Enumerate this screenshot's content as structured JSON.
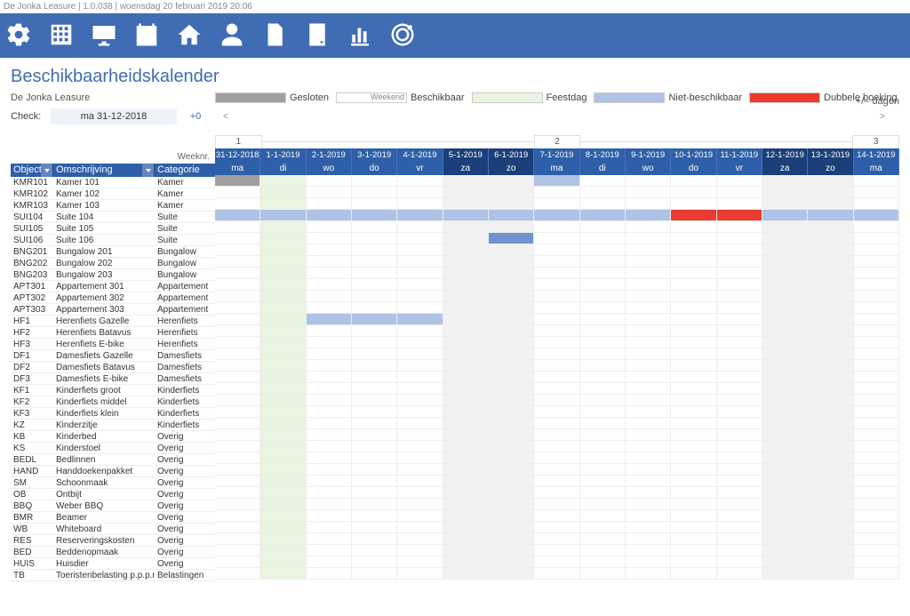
{
  "titlebar": "De Jonka Leasure | 1.0.038 | woensdag 20 februari 2019 20:06",
  "page_title": "Beschikbaarheidskalender",
  "legend_left": "De Jonka Leasure",
  "legend": {
    "gesloten": "Gesloten",
    "weekend": "Weekend",
    "beschikbaar": "Beschikbaar",
    "feestdag": "Feestdag",
    "niet_beschikbaar": "Niet-beschikbaar",
    "dubbele_boeking": "Dubbele boeking"
  },
  "colors": {
    "gesloten": "#9fa0a1",
    "weekend_swatch": "#ffffff",
    "weekend_label_bg": "#eeeeee",
    "beschikbaar": "#ffffff",
    "feestdag": "#e9f5e0",
    "niet_beschikbaar": "#aec3e6",
    "dubbele_boeking": "#e93b2f",
    "header_blue": "#2E5FA9"
  },
  "check": {
    "label": "Check:",
    "date": "ma 31-12-2018",
    "offset": "+0",
    "dagen_label": "+/– dagen"
  },
  "weeknr_label": "Weeknr.",
  "headers": {
    "object": "Object",
    "omschrijving": "Omschrijving",
    "categorie": "Categorie"
  },
  "dates": [
    {
      "date": "31-12-2018",
      "day": "ma"
    },
    {
      "date": "1-1-2019",
      "day": "di"
    },
    {
      "date": "2-1-2019",
      "day": "wo"
    },
    {
      "date": "3-1-2019",
      "day": "do"
    },
    {
      "date": "4-1-2019",
      "day": "vr"
    },
    {
      "date": "5-1-2019",
      "day": "za"
    },
    {
      "date": "6-1-2019",
      "day": "zo"
    },
    {
      "date": "7-1-2019",
      "day": "ma"
    },
    {
      "date": "8-1-2019",
      "day": "di"
    },
    {
      "date": "9-1-2019",
      "day": "wo"
    },
    {
      "date": "10-1-2019",
      "day": "do"
    },
    {
      "date": "11-1-2019",
      "day": "vr"
    },
    {
      "date": "12-1-2019",
      "day": "za"
    },
    {
      "date": "13-1-2019",
      "day": "zo"
    },
    {
      "date": "14-1-2019",
      "day": "ma"
    }
  ],
  "weeknrs": [
    {
      "label": "1",
      "span": 1
    },
    {
      "label": "",
      "span": 6
    },
    {
      "label": "2",
      "span": 1
    },
    {
      "label": "",
      "span": 6
    },
    {
      "label": "3",
      "span": 1
    }
  ],
  "rows": [
    {
      "obj": "KMR101",
      "oms": "Kamer 101",
      "cat": "Kamer",
      "cells": [
        "closed",
        "feest",
        "",
        "",
        "",
        "weekend",
        "weekend",
        "niet",
        "",
        "",
        "",
        "",
        "weekend",
        "weekend",
        ""
      ]
    },
    {
      "obj": "KMR102",
      "oms": "Kamer 102",
      "cat": "Kamer",
      "cells": [
        "",
        "feest",
        "",
        "",
        "",
        "weekend",
        "weekend",
        "",
        "",
        "",
        "",
        "",
        "weekend",
        "weekend",
        ""
      ]
    },
    {
      "obj": "KMR103",
      "oms": "Kamer 103",
      "cat": "Kamer",
      "cells": [
        "",
        "feest",
        "",
        "",
        "",
        "weekend",
        "weekend",
        "",
        "",
        "",
        "",
        "",
        "weekend",
        "weekend",
        ""
      ]
    },
    {
      "obj": "SUI104",
      "oms": "Suite 104",
      "cat": "Suite",
      "cells": [
        "niet",
        "niet",
        "niet",
        "niet",
        "niet",
        "niet",
        "niet",
        "niet",
        "niet",
        "niet",
        "dubbel",
        "dubbel",
        "niet",
        "niet",
        "niet"
      ]
    },
    {
      "obj": "SUI105",
      "oms": "Suite 105",
      "cat": "Suite",
      "cells": [
        "",
        "feest",
        "",
        "",
        "",
        "weekend",
        "weekend",
        "",
        "",
        "",
        "",
        "",
        "weekend",
        "weekend",
        ""
      ]
    },
    {
      "obj": "SUI106",
      "oms": "Suite 106",
      "cat": "Suite",
      "cells": [
        "",
        "feest",
        "",
        "",
        "",
        "weekend",
        "niethl",
        "",
        "",
        "",
        "",
        "",
        "weekend",
        "weekend",
        ""
      ]
    },
    {
      "obj": "BNG201",
      "oms": "Bungalow 201",
      "cat": "Bungalow",
      "cells": [
        "",
        "feest",
        "",
        "",
        "",
        "weekend",
        "weekend",
        "",
        "",
        "",
        "",
        "",
        "weekend",
        "weekend",
        ""
      ]
    },
    {
      "obj": "BNG202",
      "oms": "Bungalow 202",
      "cat": "Bungalow",
      "cells": [
        "",
        "feest",
        "",
        "",
        "",
        "weekend",
        "weekend",
        "",
        "",
        "",
        "",
        "",
        "weekend",
        "weekend",
        ""
      ]
    },
    {
      "obj": "BNG203",
      "oms": "Bungalow 203",
      "cat": "Bungalow",
      "cells": [
        "",
        "feest",
        "",
        "",
        "",
        "weekend",
        "weekend",
        "",
        "",
        "",
        "",
        "",
        "weekend",
        "weekend",
        ""
      ]
    },
    {
      "obj": "APT301",
      "oms": "Appartement 301",
      "cat": "Appartement",
      "cells": [
        "",
        "feest",
        "",
        "",
        "",
        "weekend",
        "weekend",
        "",
        "",
        "",
        "",
        "",
        "weekend",
        "weekend",
        ""
      ]
    },
    {
      "obj": "APT302",
      "oms": "Appartement 302",
      "cat": "Appartement",
      "cells": [
        "",
        "feest",
        "",
        "",
        "",
        "weekend",
        "weekend",
        "",
        "",
        "",
        "",
        "",
        "weekend",
        "weekend",
        ""
      ]
    },
    {
      "obj": "APT303",
      "oms": "Appartement 303",
      "cat": "Appartement",
      "cells": [
        "",
        "feest",
        "",
        "",
        "",
        "weekend",
        "weekend",
        "",
        "",
        "",
        "",
        "",
        "weekend",
        "weekend",
        ""
      ]
    },
    {
      "obj": "HF1",
      "oms": "Herenfiets Gazelle",
      "cat": "Herenfiets",
      "cells": [
        "",
        "feest",
        "niet",
        "niet",
        "niet",
        "weekend",
        "weekend",
        "",
        "",
        "",
        "",
        "",
        "weekend",
        "weekend",
        ""
      ]
    },
    {
      "obj": "HF2",
      "oms": "Herenfiets Batavus",
      "cat": "Herenfiets",
      "cells": [
        "",
        "feest",
        "",
        "",
        "",
        "weekend",
        "weekend",
        "",
        "",
        "",
        "",
        "",
        "weekend",
        "weekend",
        ""
      ]
    },
    {
      "obj": "HF3",
      "oms": "Herenfiets E-bike",
      "cat": "Herenfiets",
      "cells": [
        "",
        "feest",
        "",
        "",
        "",
        "weekend",
        "weekend",
        "",
        "",
        "",
        "",
        "",
        "weekend",
        "weekend",
        ""
      ]
    },
    {
      "obj": "DF1",
      "oms": "Damesfiets Gazelle",
      "cat": "Damesfiets",
      "cells": [
        "",
        "feest",
        "",
        "",
        "",
        "weekend",
        "weekend",
        "",
        "",
        "",
        "",
        "",
        "weekend",
        "weekend",
        ""
      ]
    },
    {
      "obj": "DF2",
      "oms": "Damesfiets Batavus",
      "cat": "Damesfiets",
      "cells": [
        "",
        "feest",
        "",
        "",
        "",
        "weekend",
        "weekend",
        "",
        "",
        "",
        "",
        "",
        "weekend",
        "weekend",
        ""
      ]
    },
    {
      "obj": "DF3",
      "oms": "Damesfiets E-bike",
      "cat": "Damesfiets",
      "cells": [
        "",
        "feest",
        "",
        "",
        "",
        "weekend",
        "weekend",
        "",
        "",
        "",
        "",
        "",
        "weekend",
        "weekend",
        ""
      ]
    },
    {
      "obj": "KF1",
      "oms": "Kinderfiets groot",
      "cat": "Kinderfiets",
      "cells": [
        "",
        "feest",
        "",
        "",
        "",
        "weekend",
        "weekend",
        "",
        "",
        "",
        "",
        "",
        "weekend",
        "weekend",
        ""
      ]
    },
    {
      "obj": "KF2",
      "oms": "Kinderfiets middel",
      "cat": "Kinderfiets",
      "cells": [
        "",
        "feest",
        "",
        "",
        "",
        "weekend",
        "weekend",
        "",
        "",
        "",
        "",
        "",
        "weekend",
        "weekend",
        ""
      ]
    },
    {
      "obj": "KF3",
      "oms": "Kinderfiets klein",
      "cat": "Kinderfiets",
      "cells": [
        "",
        "feest",
        "",
        "",
        "",
        "weekend",
        "weekend",
        "",
        "",
        "",
        "",
        "",
        "weekend",
        "weekend",
        ""
      ]
    },
    {
      "obj": "KZ",
      "oms": "Kinderzitje",
      "cat": "Kinderfiets",
      "cells": [
        "",
        "feest",
        "",
        "",
        "",
        "weekend",
        "weekend",
        "",
        "",
        "",
        "",
        "",
        "weekend",
        "weekend",
        ""
      ]
    },
    {
      "obj": "KB",
      "oms": "Kinderbed",
      "cat": "Overig",
      "cells": [
        "",
        "feest",
        "",
        "",
        "",
        "weekend",
        "weekend",
        "",
        "",
        "",
        "",
        "",
        "weekend",
        "weekend",
        ""
      ]
    },
    {
      "obj": "KS",
      "oms": "Kinderstoel",
      "cat": "Overig",
      "cells": [
        "",
        "feest",
        "",
        "",
        "",
        "weekend",
        "weekend",
        "",
        "",
        "",
        "",
        "",
        "weekend",
        "weekend",
        ""
      ]
    },
    {
      "obj": "BEDL",
      "oms": "Bedlinnen",
      "cat": "Overig",
      "cells": [
        "",
        "feest",
        "",
        "",
        "",
        "weekend",
        "weekend",
        "",
        "",
        "",
        "",
        "",
        "weekend",
        "weekend",
        ""
      ]
    },
    {
      "obj": "HAND",
      "oms": "Handdoekenpakket",
      "cat": "Overig",
      "cells": [
        "",
        "feest",
        "",
        "",
        "",
        "weekend",
        "weekend",
        "",
        "",
        "",
        "",
        "",
        "weekend",
        "weekend",
        ""
      ]
    },
    {
      "obj": "SM",
      "oms": "Schoonmaak",
      "cat": "Overig",
      "cells": [
        "",
        "feest",
        "",
        "",
        "",
        "weekend",
        "weekend",
        "",
        "",
        "",
        "",
        "",
        "weekend",
        "weekend",
        ""
      ]
    },
    {
      "obj": "OB",
      "oms": "Ontbijt",
      "cat": "Overig",
      "cells": [
        "",
        "feest",
        "",
        "",
        "",
        "weekend",
        "weekend",
        "",
        "",
        "",
        "",
        "",
        "weekend",
        "weekend",
        ""
      ]
    },
    {
      "obj": "BBQ",
      "oms": "Weber BBQ",
      "cat": "Overig",
      "cells": [
        "",
        "feest",
        "",
        "",
        "",
        "weekend",
        "weekend",
        "",
        "",
        "",
        "",
        "",
        "weekend",
        "weekend",
        ""
      ]
    },
    {
      "obj": "BMR",
      "oms": "Beamer",
      "cat": "Overig",
      "cells": [
        "",
        "feest",
        "",
        "",
        "",
        "weekend",
        "weekend",
        "",
        "",
        "",
        "",
        "",
        "weekend",
        "weekend",
        ""
      ]
    },
    {
      "obj": "WB",
      "oms": "Whiteboard",
      "cat": "Overig",
      "cells": [
        "",
        "feest",
        "",
        "",
        "",
        "weekend",
        "weekend",
        "",
        "",
        "",
        "",
        "",
        "weekend",
        "weekend",
        ""
      ]
    },
    {
      "obj": "RES",
      "oms": "Reserveringskosten",
      "cat": "Overig",
      "cells": [
        "",
        "feest",
        "",
        "",
        "",
        "weekend",
        "weekend",
        "",
        "",
        "",
        "",
        "",
        "weekend",
        "weekend",
        ""
      ]
    },
    {
      "obj": "BED",
      "oms": "Beddenopmaak",
      "cat": "Overig",
      "cells": [
        "",
        "feest",
        "",
        "",
        "",
        "weekend",
        "weekend",
        "",
        "",
        "",
        "",
        "",
        "weekend",
        "weekend",
        ""
      ]
    },
    {
      "obj": "HUIS",
      "oms": "Huisdier",
      "cat": "Overig",
      "cells": [
        "",
        "feest",
        "",
        "",
        "",
        "weekend",
        "weekend",
        "",
        "",
        "",
        "",
        "",
        "weekend",
        "weekend",
        ""
      ]
    },
    {
      "obj": "TB",
      "oms": "Toeristenbelasting p.p.p.n.",
      "cat": "Belastingen",
      "cells": [
        "",
        "feest",
        "",
        "",
        "",
        "weekend",
        "weekend",
        "",
        "",
        "",
        "",
        "",
        "weekend",
        "weekend",
        ""
      ]
    }
  ]
}
